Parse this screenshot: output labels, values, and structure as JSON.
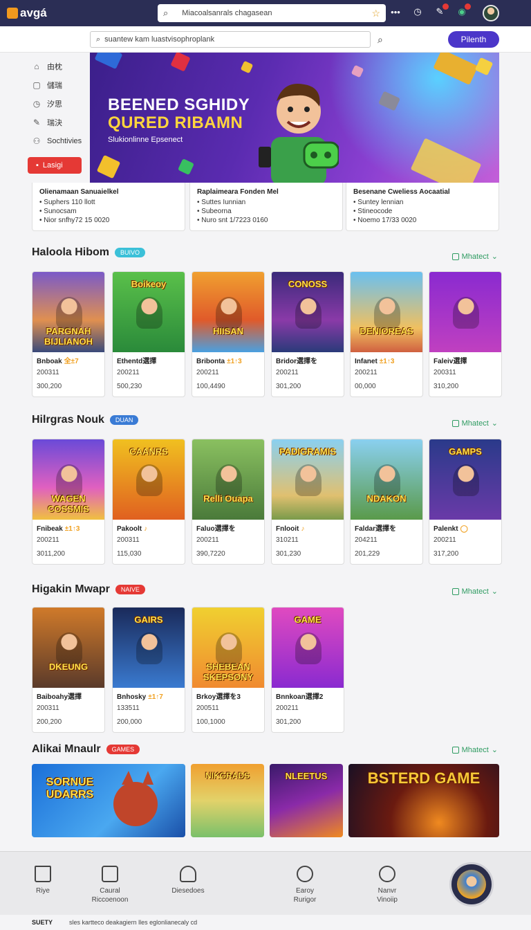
{
  "app": {
    "logo_text": "avgá"
  },
  "top_search": {
    "placeholder": "Miacoalsanrals chagasean"
  },
  "sub_search": {
    "placeholder": "suantew kam luastvisophroplank"
  },
  "primary_button": "Pilenth",
  "sidebar": {
    "items": [
      {
        "label": "由枕",
        "icon": "home-icon"
      },
      {
        "label": "儲瑞",
        "icon": "box-icon"
      },
      {
        "label": "汐思",
        "icon": "clock-icon"
      },
      {
        "label": "瑞決",
        "icon": "pen-icon"
      },
      {
        "label": "Sochtivies",
        "icon": "people-icon"
      }
    ],
    "action_button": "Lasigi"
  },
  "hero": {
    "title_line1": "BEENED SGHIDY",
    "title_line2": "QURED RIBAMN",
    "subtitle": "Slukionlinne Epsenect"
  },
  "news": [
    {
      "title": "Olienamaan Sanuaielkel",
      "lines": [
        "Suphers 110 llott",
        "Sunocsam",
        "Nior snfhy72 15 0020"
      ]
    },
    {
      "title": "Raplaimeara Fonden Mel",
      "lines": [
        "Suttes Iunnian",
        "Subeorna",
        "Nuro snt 1/7223 0160"
      ]
    },
    {
      "title": "Besenane Cweliess Aocaatial",
      "lines": [
        "Suntey lennian",
        "Stineocode",
        "Noemo 17/33 0020"
      ]
    }
  ],
  "sections": [
    {
      "title": "Haloola Hibom",
      "pill": "BUIVO",
      "pill_color": "#3bc0d8",
      "more": "Mhatect",
      "cards": [
        {
          "thumb_text": "PARGNAH BIJLIANOH",
          "name": "Bnboak",
          "tag": "全±7",
          "line2": "200311",
          "line3": "300,200"
        },
        {
          "thumb_text": "Boikeoy",
          "name": "Ethentd選擇",
          "tag": "",
          "line2": "200211",
          "line3": "500,230"
        },
        {
          "thumb_text": "HIISAN",
          "name": "Bribonta",
          "tag": "±1↑3",
          "line2": "200211",
          "line3": "100,4490"
        },
        {
          "thumb_text": "CONOSS",
          "name": "Bridor選擇を",
          "tag": "",
          "line2": "200211",
          "line3": "301,200"
        },
        {
          "thumb_text": "DENIOREAS",
          "name": "Infanet",
          "tag": "±1↑3",
          "line2": "200211",
          "line3": "00,000"
        },
        {
          "thumb_text": "",
          "name": "Faleiv選擇",
          "tag": "",
          "line2": "200311",
          "line3": "310,200"
        }
      ]
    },
    {
      "title": "Hilrgras Nouk",
      "pill": "DUAN",
      "pill_color": "#3a7bd5",
      "more": "Mhatect",
      "cards": [
        {
          "thumb_text": "WAGEN COSSMIS",
          "name": "Fnibeak",
          "tag": "±1↑3",
          "line2": "200211",
          "line3": "3011,200"
        },
        {
          "thumb_text": "CAANRS",
          "name": "Pakoolt",
          "tag": "♪",
          "line2": "200311",
          "line3": "115,030"
        },
        {
          "thumb_text": "Relli Ouapa",
          "name": "Faluo選擇を",
          "tag": "",
          "line2": "200211",
          "line3": "390,7220"
        },
        {
          "thumb_text": "PADIGRAMIS",
          "name": "Fnlooit",
          "tag": "♪",
          "line2": "310211",
          "line3": "301,230"
        },
        {
          "thumb_text": "NDAKON",
          "name": "Faldar選擇を",
          "tag": "",
          "line2": "204211",
          "line3": "201,229"
        },
        {
          "thumb_text": "GAMPS",
          "name": "Palenkt",
          "tag": "◯",
          "line2": "200211",
          "line3": "317,200"
        }
      ]
    },
    {
      "title": "Higakin Mwapr",
      "pill": "NAIVE",
      "pill_color": "#e53935",
      "more": "Mhatect",
      "cards": [
        {
          "thumb_text": "DKEUNG",
          "name": "Baiboahy選擇",
          "tag": "",
          "line2": "200311",
          "line3": "200,200"
        },
        {
          "thumb_text": "GAIRS",
          "name": "Bnhosky",
          "tag": "±1↑7",
          "line2": "133511",
          "line3": "200,000"
        },
        {
          "thumb_text": "SHEBEAN SKEPSONY",
          "name": "Brkoy選擇を3",
          "tag": "",
          "line2": "200511",
          "line3": "100,1000"
        },
        {
          "thumb_text": "GAME",
          "name": "Bnnkoan選擇2",
          "tag": "",
          "line2": "200211",
          "line3": "301,200"
        }
      ]
    },
    {
      "title": "Alikai Mnaulr",
      "pill": "GAMES",
      "pill_color": "#e53935",
      "more": "Mhatect",
      "wide": [
        {
          "thumb_text": "SORNUE UDARRS"
        },
        {
          "thumb_text": "NIKGRADS"
        },
        {
          "thumb_text": "NLEETUS"
        },
        {
          "thumb_text": "BSTERD GAME"
        }
      ]
    }
  ],
  "bottom_nav": [
    {
      "label": "Riye",
      "icon": "house-icon"
    },
    {
      "label": "Caural Riccoenoon",
      "icon": "calculator-icon"
    },
    {
      "label": "Diesedoes",
      "icon": "trophy-icon"
    },
    {
      "label": "Earoy Rurigor",
      "icon": "heart-icon"
    },
    {
      "label": "Nanvr Vinoiip",
      "icon": "search-icon"
    }
  ],
  "footer": {
    "brand": "SUETY",
    "text": "sles kartteco deakagiern lles eglonlianecaly cd"
  }
}
